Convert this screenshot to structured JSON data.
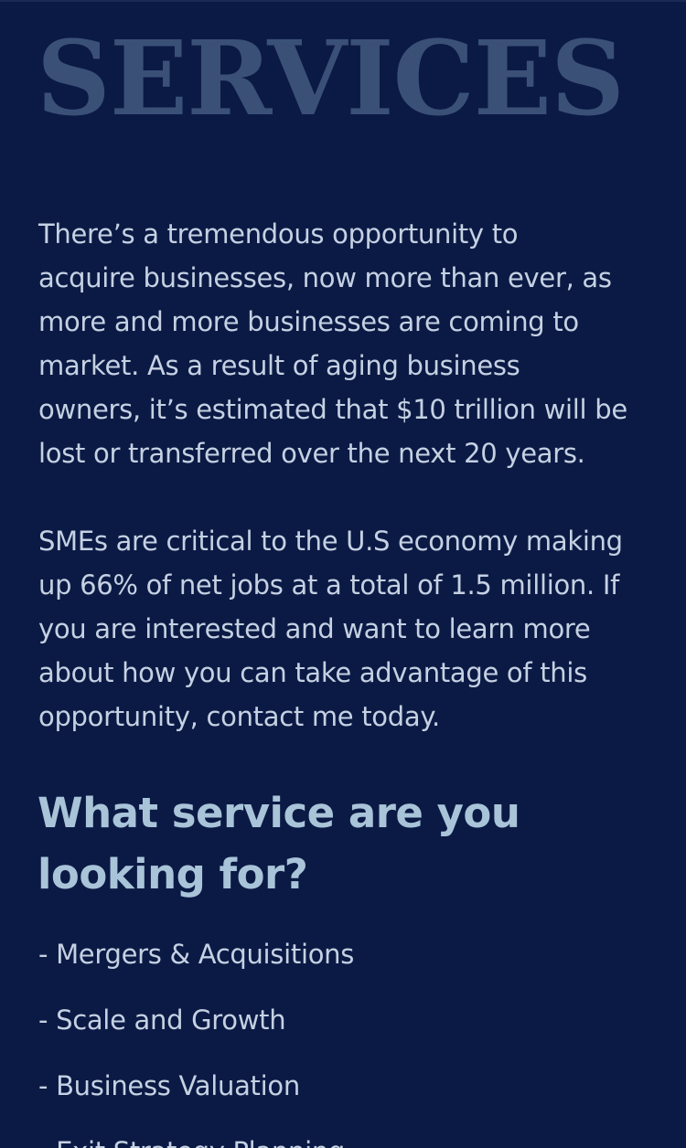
{
  "hero": {
    "title": "SERVICES"
  },
  "intro": {
    "paragraph1_lines": [
      "There’s a tremendous opportunity to",
      "acquire businesses, now more than ever, as",
      "more and more businesses are coming to",
      "market. As a result of aging business",
      "owners, it’s estimated that $10 trillion will be",
      "lost or transferred over the next 20 years."
    ],
    "paragraph2_lines": [
      "SMEs are critical to the U.S economy making",
      "up 66% of net jobs at a total of 1.5 million. If",
      "you are interested and want to learn more",
      "about how you can take advantage of this",
      "opportunity, contact me today."
    ]
  },
  "services": {
    "heading_lines": [
      "What service are you",
      "looking for?"
    ],
    "items": [
      "- Mergers & Acquisitions",
      "- Scale and Growth",
      "- Business Valuation",
      "- Exit Strategy Planning"
    ]
  },
  "colors": {
    "background": "#0b1a45",
    "title": "#3a5077",
    "body_text": "#c5d1e2",
    "subheading": "#a9c4d8"
  }
}
